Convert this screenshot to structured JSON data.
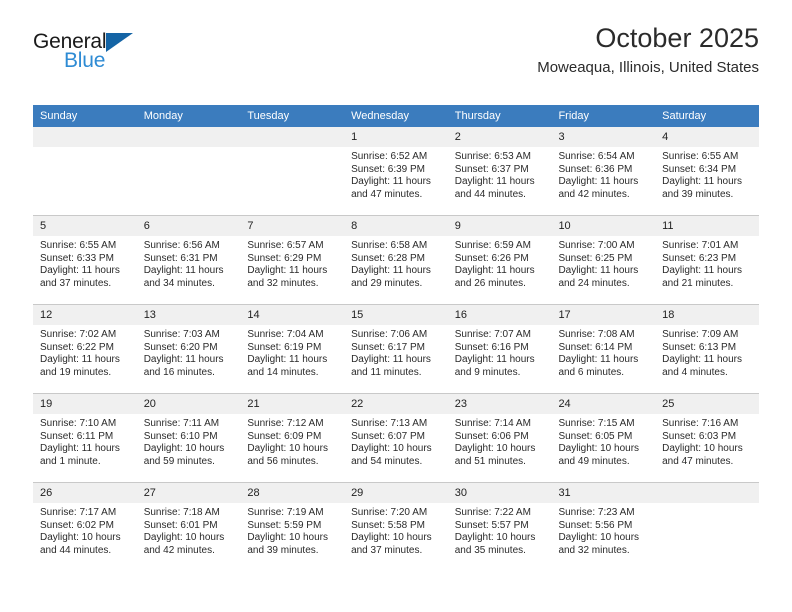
{
  "brand": {
    "name_part1": "General",
    "name_part2": "Blue",
    "logo_icon": "triangle-icon",
    "color_dark": "#1a1a1a",
    "color_blue": "#2E8BD4",
    "color_triangle": "#1464A5"
  },
  "header": {
    "title": "October 2025",
    "subtitle": "Moweaqua, Illinois, United States"
  },
  "theme": {
    "header_blue": "#3B7CBE",
    "daynum_band": "#f0f0f0",
    "grid_line": "#c9c9c9",
    "text": "#2a2a2a"
  },
  "weekday_headers": [
    "Sunday",
    "Monday",
    "Tuesday",
    "Wednesday",
    "Thursday",
    "Friday",
    "Saturday"
  ],
  "weeks": [
    {
      "days": [
        {
          "date": "",
          "empty": true,
          "sunrise": "",
          "sunset": "",
          "daylight_line1": "",
          "daylight_line2": ""
        },
        {
          "date": "",
          "empty": true,
          "sunrise": "",
          "sunset": "",
          "daylight_line1": "",
          "daylight_line2": ""
        },
        {
          "date": "",
          "empty": true,
          "sunrise": "",
          "sunset": "",
          "daylight_line1": "",
          "daylight_line2": ""
        },
        {
          "date": "1",
          "empty": false,
          "sunrise": "Sunrise: 6:52 AM",
          "sunset": "Sunset: 6:39 PM",
          "daylight_line1": "Daylight: 11 hours",
          "daylight_line2": "and 47 minutes."
        },
        {
          "date": "2",
          "empty": false,
          "sunrise": "Sunrise: 6:53 AM",
          "sunset": "Sunset: 6:37 PM",
          "daylight_line1": "Daylight: 11 hours",
          "daylight_line2": "and 44 minutes."
        },
        {
          "date": "3",
          "empty": false,
          "sunrise": "Sunrise: 6:54 AM",
          "sunset": "Sunset: 6:36 PM",
          "daylight_line1": "Daylight: 11 hours",
          "daylight_line2": "and 42 minutes."
        },
        {
          "date": "4",
          "empty": false,
          "sunrise": "Sunrise: 6:55 AM",
          "sunset": "Sunset: 6:34 PM",
          "daylight_line1": "Daylight: 11 hours",
          "daylight_line2": "and 39 minutes."
        }
      ]
    },
    {
      "days": [
        {
          "date": "5",
          "empty": false,
          "sunrise": "Sunrise: 6:55 AM",
          "sunset": "Sunset: 6:33 PM",
          "daylight_line1": "Daylight: 11 hours",
          "daylight_line2": "and 37 minutes."
        },
        {
          "date": "6",
          "empty": false,
          "sunrise": "Sunrise: 6:56 AM",
          "sunset": "Sunset: 6:31 PM",
          "daylight_line1": "Daylight: 11 hours",
          "daylight_line2": "and 34 minutes."
        },
        {
          "date": "7",
          "empty": false,
          "sunrise": "Sunrise: 6:57 AM",
          "sunset": "Sunset: 6:29 PM",
          "daylight_line1": "Daylight: 11 hours",
          "daylight_line2": "and 32 minutes."
        },
        {
          "date": "8",
          "empty": false,
          "sunrise": "Sunrise: 6:58 AM",
          "sunset": "Sunset: 6:28 PM",
          "daylight_line1": "Daylight: 11 hours",
          "daylight_line2": "and 29 minutes."
        },
        {
          "date": "9",
          "empty": false,
          "sunrise": "Sunrise: 6:59 AM",
          "sunset": "Sunset: 6:26 PM",
          "daylight_line1": "Daylight: 11 hours",
          "daylight_line2": "and 26 minutes."
        },
        {
          "date": "10",
          "empty": false,
          "sunrise": "Sunrise: 7:00 AM",
          "sunset": "Sunset: 6:25 PM",
          "daylight_line1": "Daylight: 11 hours",
          "daylight_line2": "and 24 minutes."
        },
        {
          "date": "11",
          "empty": false,
          "sunrise": "Sunrise: 7:01 AM",
          "sunset": "Sunset: 6:23 PM",
          "daylight_line1": "Daylight: 11 hours",
          "daylight_line2": "and 21 minutes."
        }
      ]
    },
    {
      "days": [
        {
          "date": "12",
          "empty": false,
          "sunrise": "Sunrise: 7:02 AM",
          "sunset": "Sunset: 6:22 PM",
          "daylight_line1": "Daylight: 11 hours",
          "daylight_line2": "and 19 minutes."
        },
        {
          "date": "13",
          "empty": false,
          "sunrise": "Sunrise: 7:03 AM",
          "sunset": "Sunset: 6:20 PM",
          "daylight_line1": "Daylight: 11 hours",
          "daylight_line2": "and 16 minutes."
        },
        {
          "date": "14",
          "empty": false,
          "sunrise": "Sunrise: 7:04 AM",
          "sunset": "Sunset: 6:19 PM",
          "daylight_line1": "Daylight: 11 hours",
          "daylight_line2": "and 14 minutes."
        },
        {
          "date": "15",
          "empty": false,
          "sunrise": "Sunrise: 7:06 AM",
          "sunset": "Sunset: 6:17 PM",
          "daylight_line1": "Daylight: 11 hours",
          "daylight_line2": "and 11 minutes."
        },
        {
          "date": "16",
          "empty": false,
          "sunrise": "Sunrise: 7:07 AM",
          "sunset": "Sunset: 6:16 PM",
          "daylight_line1": "Daylight: 11 hours",
          "daylight_line2": "and 9 minutes."
        },
        {
          "date": "17",
          "empty": false,
          "sunrise": "Sunrise: 7:08 AM",
          "sunset": "Sunset: 6:14 PM",
          "daylight_line1": "Daylight: 11 hours",
          "daylight_line2": "and 6 minutes."
        },
        {
          "date": "18",
          "empty": false,
          "sunrise": "Sunrise: 7:09 AM",
          "sunset": "Sunset: 6:13 PM",
          "daylight_line1": "Daylight: 11 hours",
          "daylight_line2": "and 4 minutes."
        }
      ]
    },
    {
      "days": [
        {
          "date": "19",
          "empty": false,
          "sunrise": "Sunrise: 7:10 AM",
          "sunset": "Sunset: 6:11 PM",
          "daylight_line1": "Daylight: 11 hours",
          "daylight_line2": "and 1 minute."
        },
        {
          "date": "20",
          "empty": false,
          "sunrise": "Sunrise: 7:11 AM",
          "sunset": "Sunset: 6:10 PM",
          "daylight_line1": "Daylight: 10 hours",
          "daylight_line2": "and 59 minutes."
        },
        {
          "date": "21",
          "empty": false,
          "sunrise": "Sunrise: 7:12 AM",
          "sunset": "Sunset: 6:09 PM",
          "daylight_line1": "Daylight: 10 hours",
          "daylight_line2": "and 56 minutes."
        },
        {
          "date": "22",
          "empty": false,
          "sunrise": "Sunrise: 7:13 AM",
          "sunset": "Sunset: 6:07 PM",
          "daylight_line1": "Daylight: 10 hours",
          "daylight_line2": "and 54 minutes."
        },
        {
          "date": "23",
          "empty": false,
          "sunrise": "Sunrise: 7:14 AM",
          "sunset": "Sunset: 6:06 PM",
          "daylight_line1": "Daylight: 10 hours",
          "daylight_line2": "and 51 minutes."
        },
        {
          "date": "24",
          "empty": false,
          "sunrise": "Sunrise: 7:15 AM",
          "sunset": "Sunset: 6:05 PM",
          "daylight_line1": "Daylight: 10 hours",
          "daylight_line2": "and 49 minutes."
        },
        {
          "date": "25",
          "empty": false,
          "sunrise": "Sunrise: 7:16 AM",
          "sunset": "Sunset: 6:03 PM",
          "daylight_line1": "Daylight: 10 hours",
          "daylight_line2": "and 47 minutes."
        }
      ]
    },
    {
      "days": [
        {
          "date": "26",
          "empty": false,
          "sunrise": "Sunrise: 7:17 AM",
          "sunset": "Sunset: 6:02 PM",
          "daylight_line1": "Daylight: 10 hours",
          "daylight_line2": "and 44 minutes."
        },
        {
          "date": "27",
          "empty": false,
          "sunrise": "Sunrise: 7:18 AM",
          "sunset": "Sunset: 6:01 PM",
          "daylight_line1": "Daylight: 10 hours",
          "daylight_line2": "and 42 minutes."
        },
        {
          "date": "28",
          "empty": false,
          "sunrise": "Sunrise: 7:19 AM",
          "sunset": "Sunset: 5:59 PM",
          "daylight_line1": "Daylight: 10 hours",
          "daylight_line2": "and 39 minutes."
        },
        {
          "date": "29",
          "empty": false,
          "sunrise": "Sunrise: 7:20 AM",
          "sunset": "Sunset: 5:58 PM",
          "daylight_line1": "Daylight: 10 hours",
          "daylight_line2": "and 37 minutes."
        },
        {
          "date": "30",
          "empty": false,
          "sunrise": "Sunrise: 7:22 AM",
          "sunset": "Sunset: 5:57 PM",
          "daylight_line1": "Daylight: 10 hours",
          "daylight_line2": "and 35 minutes."
        },
        {
          "date": "31",
          "empty": false,
          "sunrise": "Sunrise: 7:23 AM",
          "sunset": "Sunset: 5:56 PM",
          "daylight_line1": "Daylight: 10 hours",
          "daylight_line2": "and 32 minutes."
        },
        {
          "date": "",
          "empty": true,
          "sunrise": "",
          "sunset": "",
          "daylight_line1": "",
          "daylight_line2": ""
        }
      ]
    }
  ]
}
